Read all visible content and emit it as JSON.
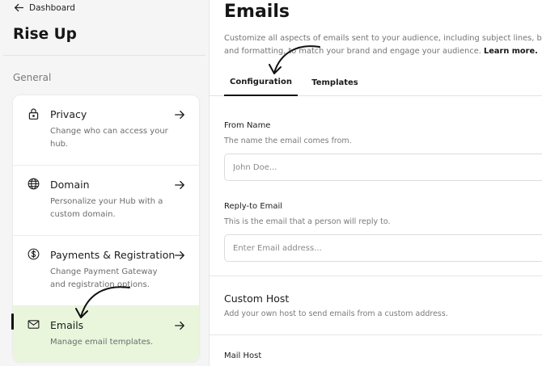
{
  "nav": {
    "back_label": "Dashboard"
  },
  "app": {
    "title": "Rise Up"
  },
  "sidebar": {
    "section_label": "General",
    "items": [
      {
        "title": "Privacy",
        "description": "Change who can access your hub.",
        "icon": "lock-icon"
      },
      {
        "title": "Domain",
        "description": "Personalize your Hub with a custom domain.",
        "icon": "globe-icon"
      },
      {
        "title": "Payments & Registration",
        "description": "Change Payment Gateway and registration options.",
        "icon": "dollar-icon"
      },
      {
        "title": "Emails",
        "description": "Manage email templates.",
        "icon": "mail-icon"
      }
    ]
  },
  "main": {
    "title": "Emails",
    "description_line1": "Customize all aspects of emails sent to your audience, including subject lines, body co",
    "description_line2": "and formatting, to match your brand and engage your audience.",
    "learn_more": "Learn more.",
    "tabs": [
      {
        "label": "Configuration",
        "active": true
      },
      {
        "label": "Templates",
        "active": false
      }
    ],
    "fields": {
      "from_name": {
        "label": "From Name",
        "help": "The name the email comes from.",
        "placeholder": "John Doe..."
      },
      "reply_to": {
        "label": "Reply-to Email",
        "help": "This is the email that a person will reply to.",
        "placeholder": "Enter Email address..."
      }
    },
    "custom_host": {
      "title": "Custom Host",
      "description": "Add your own host to send emails from a custom address."
    },
    "mail_host": {
      "label": "Mail Host"
    }
  },
  "colors": {
    "active_bg": "#e9f6dc",
    "sidebar_bg": "#f4f5f4",
    "accent": "#111111"
  }
}
